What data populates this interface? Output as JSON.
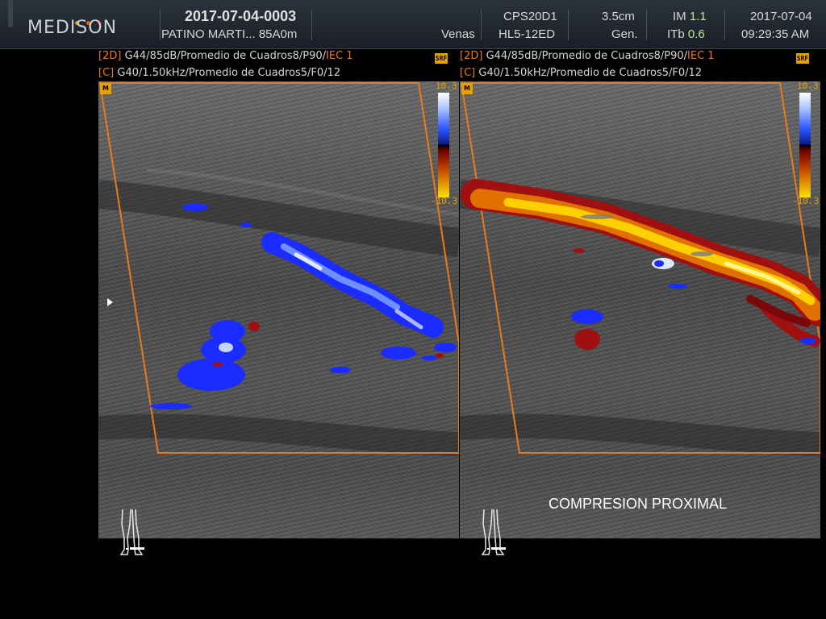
{
  "header": {
    "brand": "MEDISON",
    "study_id": "2017-07-04-0003",
    "patient": "PATINO MARTI... 85A0m",
    "preset": "Venas",
    "probe_mode": "CPS20D1",
    "probe": "HL5-12ED",
    "depth": "3.5cm",
    "gen": "Gen.",
    "im_label": "IM",
    "im_value": "1.1",
    "itb_label": "ITb",
    "itb_value": "0.6",
    "date": "2017-07-04",
    "time": "09:29:35 AM"
  },
  "left_panel": {
    "line1_tag": "[2D]",
    "line1_text": "G44/85dB/Promedio de Cuadros8/P90/",
    "line1_iec": "IEC 1",
    "line2_tag": "[C]",
    "line2_text": "G40/1.50kHz/Promedio de Cuadros5/F0/12",
    "srf": "SRF",
    "scale_top": "10.3",
    "scale_bottom": "-10.3",
    "m_badge": "M"
  },
  "right_panel": {
    "line1_tag": "[2D]",
    "line1_text": "G44/85dB/Promedio de Cuadros8/P90/",
    "line1_iec": "IEC 1",
    "line2_tag": "[C]",
    "line2_text": "G40/1.50kHz/Promedio de Cuadros5/F0/12",
    "srf": "SRF",
    "scale_top": "10.3",
    "scale_bottom": "-10.3",
    "m_badge": "M",
    "caption": "COMPRESION PROXIMAL"
  },
  "colors": {
    "accent_orange": "#e87a1e",
    "doppler_blue": "#1a2cff",
    "doppler_red": "#a01010",
    "doppler_yellow": "#ffd000",
    "value_green": "#b9e69e"
  },
  "icons": {
    "pointer": "triangle-pointer-icon",
    "body_mark": "legs-bodymark-icon",
    "brand_dots": "medison-dots-icon"
  }
}
